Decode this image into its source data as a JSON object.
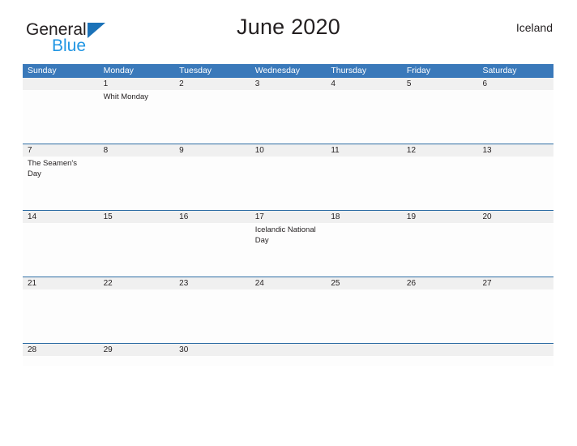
{
  "brand": {
    "word1": "General",
    "word2": "Blue",
    "flag_icon": "triangle-flag-icon",
    "accent_color": "#1b72b8",
    "blue_text_color": "#2196e3"
  },
  "header": {
    "title": "June 2020",
    "locale": "Iceland"
  },
  "calendar": {
    "header_bg": "#3a79ba",
    "date_band_bg": "#f0f0f0",
    "row_border_color": "#2e6da4",
    "weekdays": [
      "Sunday",
      "Monday",
      "Tuesday",
      "Wednesday",
      "Thursday",
      "Friday",
      "Saturday"
    ],
    "weeks": [
      {
        "days": [
          {
            "date": "",
            "event": ""
          },
          {
            "date": "1",
            "event": "Whit Monday"
          },
          {
            "date": "2",
            "event": ""
          },
          {
            "date": "3",
            "event": ""
          },
          {
            "date": "4",
            "event": ""
          },
          {
            "date": "5",
            "event": ""
          },
          {
            "date": "6",
            "event": ""
          }
        ]
      },
      {
        "days": [
          {
            "date": "7",
            "event": "The Seamen's Day"
          },
          {
            "date": "8",
            "event": ""
          },
          {
            "date": "9",
            "event": ""
          },
          {
            "date": "10",
            "event": ""
          },
          {
            "date": "11",
            "event": ""
          },
          {
            "date": "12",
            "event": ""
          },
          {
            "date": "13",
            "event": ""
          }
        ]
      },
      {
        "days": [
          {
            "date": "14",
            "event": ""
          },
          {
            "date": "15",
            "event": ""
          },
          {
            "date": "16",
            "event": ""
          },
          {
            "date": "17",
            "event": "Icelandic National Day"
          },
          {
            "date": "18",
            "event": ""
          },
          {
            "date": "19",
            "event": ""
          },
          {
            "date": "20",
            "event": ""
          }
        ]
      },
      {
        "days": [
          {
            "date": "21",
            "event": ""
          },
          {
            "date": "22",
            "event": ""
          },
          {
            "date": "23",
            "event": ""
          },
          {
            "date": "24",
            "event": ""
          },
          {
            "date": "25",
            "event": ""
          },
          {
            "date": "26",
            "event": ""
          },
          {
            "date": "27",
            "event": ""
          }
        ]
      },
      {
        "short": true,
        "days": [
          {
            "date": "28",
            "event": ""
          },
          {
            "date": "29",
            "event": ""
          },
          {
            "date": "30",
            "event": ""
          },
          {
            "date": "",
            "event": ""
          },
          {
            "date": "",
            "event": ""
          },
          {
            "date": "",
            "event": ""
          },
          {
            "date": "",
            "event": ""
          }
        ]
      }
    ]
  }
}
